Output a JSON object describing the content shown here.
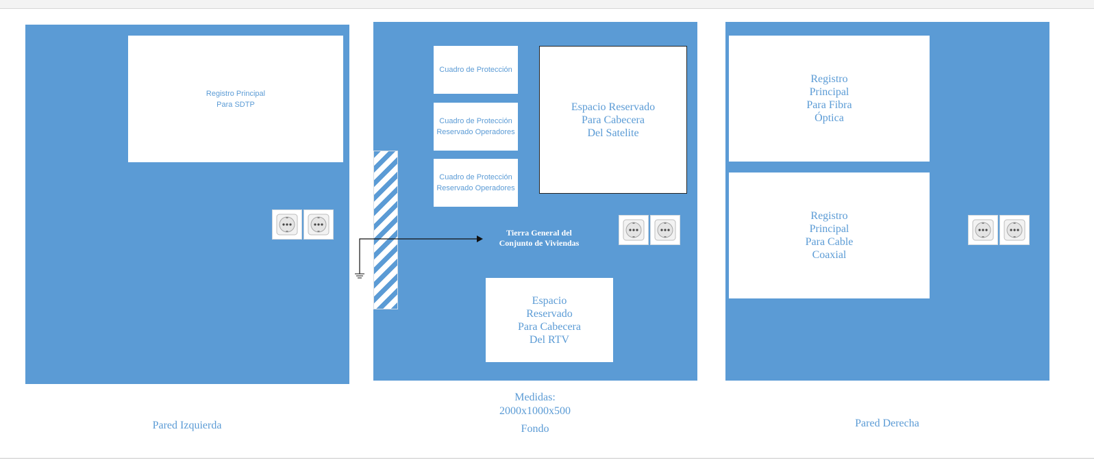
{
  "walls": {
    "left": {
      "caption": "Pared Izquierda",
      "registro": "Registro Principal\nPara SDTP"
    },
    "back": {
      "caption": "Fondo",
      "dimensions": "Medidas:\n2000x1000x500",
      "cuadro_proteccion": "Cuadro de Protección",
      "cuadro_operadores_1": "Cuadro de Protección\nReservado Operadores",
      "cuadro_operadores_2": "Cuadro de Protección\nReservado Operadores",
      "espacio_satelite": "Espacio Reservado\nPara Cabecera\nDel Satelite",
      "espacio_rtv": "Espacio\nReservado\nPara Cabecera\nDel RTV",
      "tierra": "Tierra General del\nConjunto de Viviendas"
    },
    "right": {
      "caption": "Pared Derecha",
      "registro_fibra": "Registro\nPrincipal\nPara Fibra\nÓptica",
      "registro_coaxial": "Registro\nPrincipal\nPara Cable\nCoaxial"
    }
  },
  "icons": {
    "outlet": "schuko-socket-icon",
    "ground": "earth-ground-icon",
    "arrow": "arrow-right-icon"
  },
  "colors": {
    "wall": "#5b9bd5",
    "box": "#ffffff",
    "text": "#5b9bd5",
    "ground_label": "#ffffff"
  }
}
